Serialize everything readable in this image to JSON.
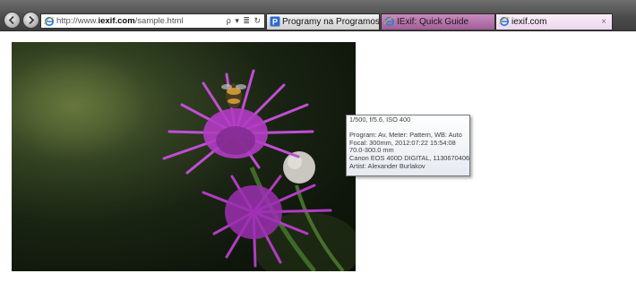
{
  "browser": {
    "address_bar": {
      "url_prefix": "http://www.",
      "url_domain": "iexif.com",
      "url_path": "/sample.html",
      "tools": "ρ ▾ ≣ ↻"
    },
    "tabs": [
      {
        "label": "Programy na Programosy.pl - ...",
        "icon": "p-favicon"
      },
      {
        "label": "IExif: Quick Guide",
        "icon": "ie-favicon"
      },
      {
        "label": "iexif.com",
        "icon": "ie-favicon",
        "close": "×",
        "active": true
      }
    ]
  },
  "tooltip": {
    "exposure": "1/500, f/5.6, ISO 400",
    "program": "Program: Av, Meter: Pattern, WB: Auto",
    "focal": "Focal: 300mm, 2012:07:22 15:54:08",
    "lens": "70.0-300.0 mm",
    "camera": "Canon EOS 400D DIGITAL, 1130670406",
    "artist": "Artist: Alexander Burlakov"
  },
  "colors": {
    "toolbar": "#4c4c4c",
    "flower": "#b23cc4",
    "tab_highlight": "#a25d98"
  }
}
